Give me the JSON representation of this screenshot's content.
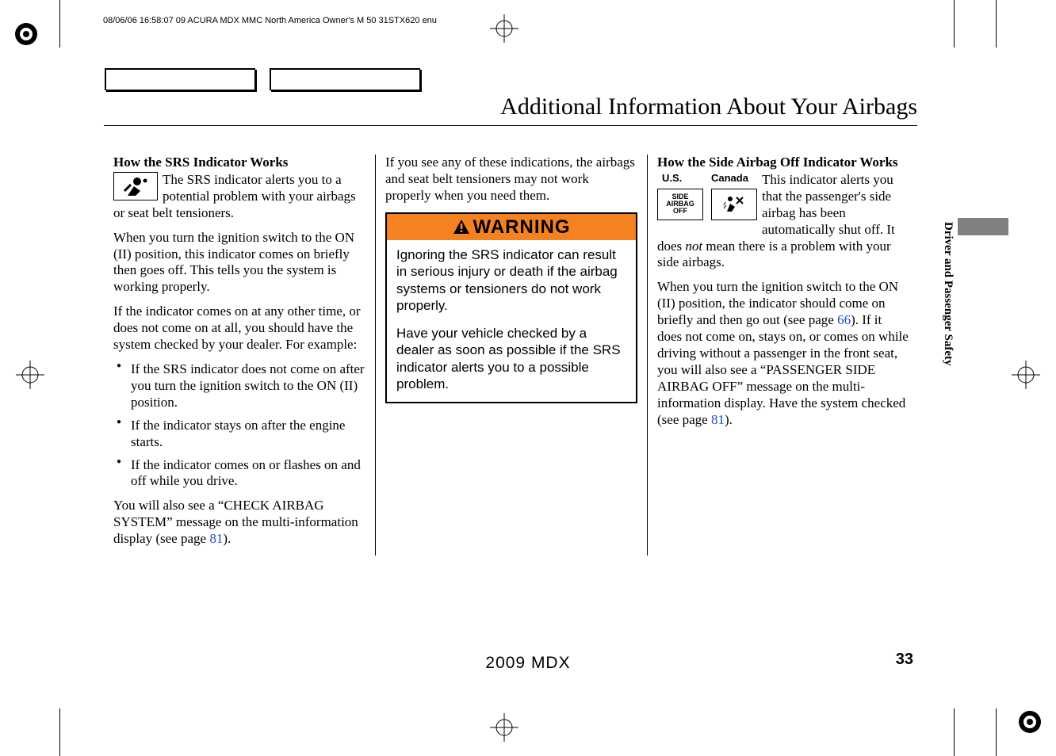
{
  "print_header": "08/06/06 16:58:07   09 ACURA MDX MMC North America Owner's M 50 31STX620 enu",
  "page_title": "Additional Information About Your Airbags",
  "side_tab": "Driver and Passenger Safety",
  "page_number": "33",
  "footer_model": "2009  MDX",
  "col1": {
    "h1": "How the SRS Indicator Works",
    "p1": "The SRS indicator alerts you to a potential problem with your airbags or seat belt tensioners.",
    "p2": "When you turn the ignition switch to the ON (II) position, this indicator comes on briefly then goes off. This tells you the system is working properly.",
    "p3": "If the indicator comes on at any other time, or does not come on at all, you should have the system checked by your dealer. For example:",
    "li1": "If the SRS indicator does not come on after you turn the ignition switch to the ON (II) position.",
    "li2": "If the indicator stays on after the engine starts.",
    "li3": "If the indicator comes on or flashes on and off while you drive.",
    "p4a": "You will also see a ",
    "p4quote": "“CHECK AIRBAG SYSTEM”",
    "p4b": " message on the multi-information display (see page ",
    "p4link": "81",
    "p4c": ")."
  },
  "col2": {
    "p1": "If you see any of these indications, the airbags and seat belt tensioners may not work properly when you need them.",
    "warn_label": "WARNING",
    "warn_p1": "Ignoring the SRS indicator can result in serious injury or death if the airbag systems or tensioners do not work properly.",
    "warn_p2": "Have your vehicle checked by a dealer as soon as possible if the SRS indicator alerts you to a possible problem."
  },
  "col3": {
    "h1": "How the Side Airbag Off Indicator Works",
    "label_us": "U.S.",
    "label_ca": "Canada",
    "icon_text1": "SIDE",
    "icon_text2": "AIRBAG",
    "icon_text3": "OFF",
    "p1a": "This indicator alerts you that the passenger's side airbag has been automatically shut off. It does ",
    "p1not": "not",
    "p1b": " mean there is a problem with your side airbags.",
    "p2a": "When you turn the ignition switch to the ON (II) position, the indicator should come on briefly and then go out (see page ",
    "p2link1": "66",
    "p2b": "). If it does not come on, stays on, or comes on while driving without a passenger in the front seat, you will also see a ",
    "p2quote": "“PASSENGER SIDE AIRBAG OFF”",
    "p2c": " message on the multi-information display. Have the system checked (see page ",
    "p2link2": "81",
    "p2d": ")."
  }
}
